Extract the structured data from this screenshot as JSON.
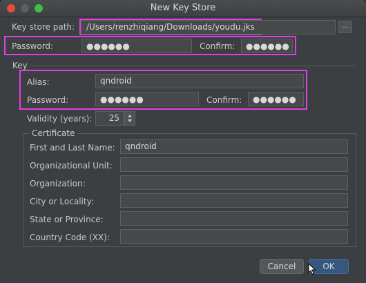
{
  "window": {
    "title": "New Key Store"
  },
  "key_store": {
    "path_label": "Key store path:",
    "path_value": "/Users/renzhiqiang/Downloads/youdu.jks",
    "browse_label": "...",
    "password_label": "Password:",
    "password_value": "●●●●●●",
    "confirm_label": "Confirm:",
    "confirm_value": "●●●●●●"
  },
  "key": {
    "section_label": "Key",
    "alias_label": "Alias:",
    "alias_value": "qndroid",
    "password_label": "Password:",
    "password_value": "●●●●●●",
    "confirm_label": "Confirm:",
    "confirm_value": "●●●●●●",
    "validity_label": "Validity (years):",
    "validity_value": "25"
  },
  "certificate": {
    "section_label": "Certificate",
    "fields": [
      {
        "label": "First and Last Name:",
        "value": "qndroid"
      },
      {
        "label": "Organizational Unit:",
        "value": ""
      },
      {
        "label": "Organization:",
        "value": ""
      },
      {
        "label": "City or Locality:",
        "value": ""
      },
      {
        "label": "State or Province:",
        "value": ""
      },
      {
        "label": "Country Code (XX):",
        "value": ""
      }
    ]
  },
  "buttons": {
    "cancel": "Cancel",
    "ok": "OK"
  },
  "colors": {
    "highlight": "#e23ee6",
    "ok_button": "#365880",
    "background": "#3c3f41"
  }
}
